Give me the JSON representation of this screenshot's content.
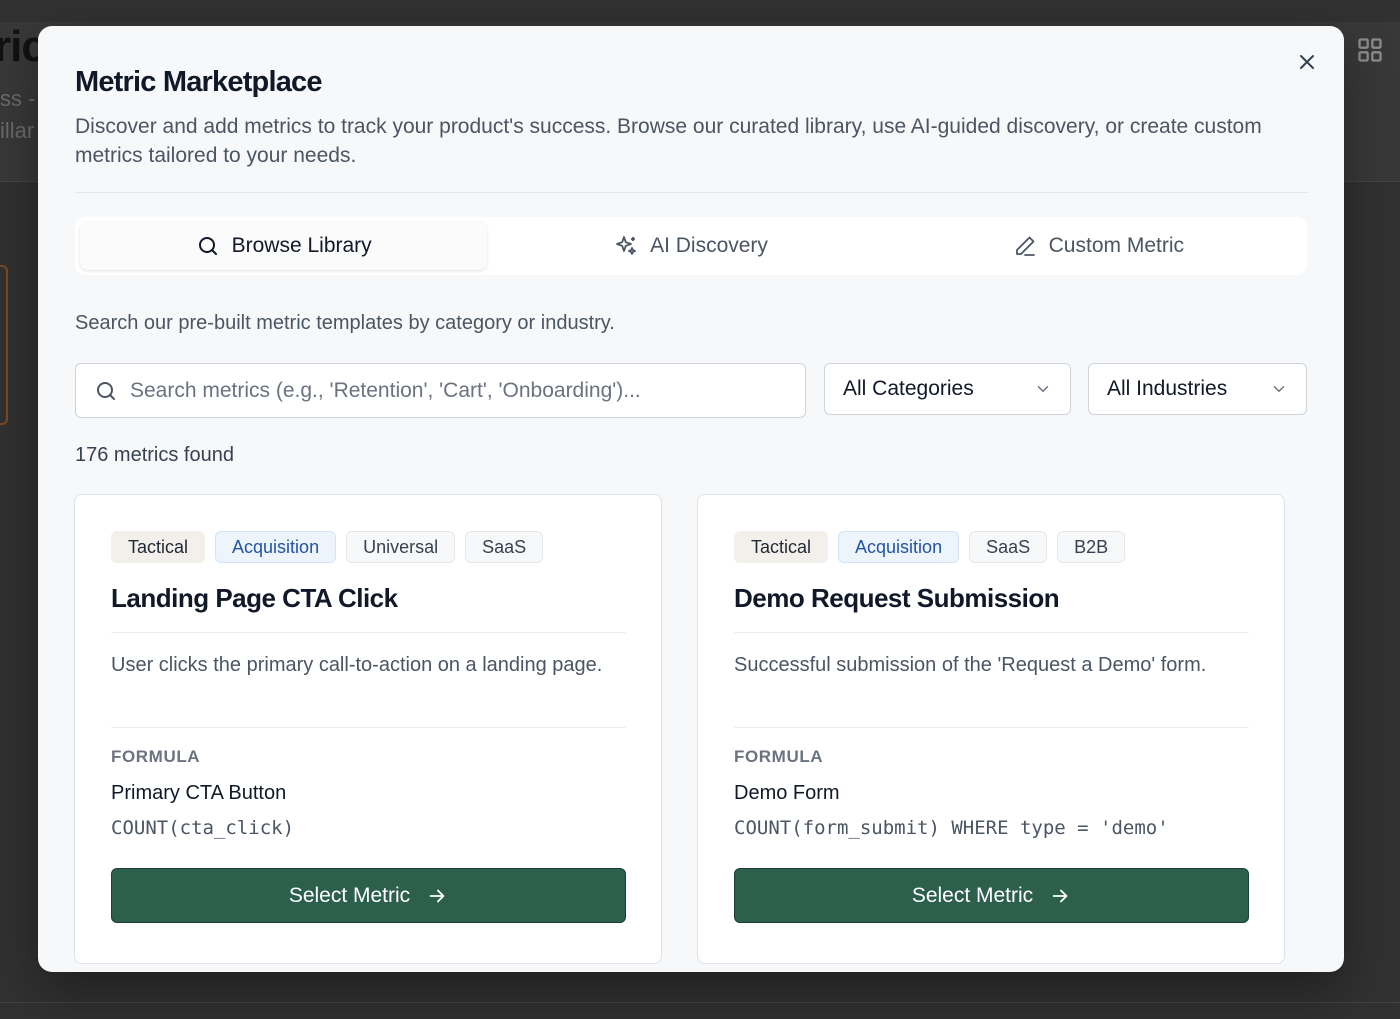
{
  "background": {
    "title_fragment": "ric",
    "subtitle_fragment_1": "ss -",
    "subtitle_fragment_2": "illar",
    "grid_icon": "grid-icon"
  },
  "modal": {
    "title": "Metric Marketplace",
    "description": "Discover and add metrics to track your product's success. Browse our curated library, use AI-guided discovery, or create custom metrics tailored to your needs.",
    "close_icon": "close-icon",
    "tabs": [
      {
        "label": "Browse Library",
        "icon": "search-icon",
        "active": true
      },
      {
        "label": "AI Discovery",
        "icon": "sparkles-icon",
        "active": false
      },
      {
        "label": "Custom Metric",
        "icon": "pencil-icon",
        "active": false
      }
    ],
    "browse_hint": "Search our pre-built metric templates by category or industry.",
    "search": {
      "placeholder": "Search metrics (e.g., 'Retention', 'Cart', 'Onboarding')...",
      "value": ""
    },
    "filters": {
      "category": "All Categories",
      "industry": "All Industries"
    },
    "results_count": "176 metrics found",
    "cards": [
      {
        "tags": [
          "Tactical",
          "Acquisition",
          "Universal",
          "SaaS"
        ],
        "title": "Landing Page CTA Click",
        "description": "User clicks the primary call-to-action on a landing page.",
        "formula_label": "FORMULA",
        "formula_name": "Primary CTA Button",
        "formula_expr": "COUNT(cta_click)",
        "button_label": "Select Metric"
      },
      {
        "tags": [
          "Tactical",
          "Acquisition",
          "SaaS",
          "B2B"
        ],
        "title": "Demo Request Submission",
        "description": "Successful submission of the 'Request a Demo' form.",
        "formula_label": "FORMULA",
        "formula_name": "Demo Form",
        "formula_expr": "COUNT(form_submit) WHERE type = 'demo'",
        "button_label": "Select Metric"
      }
    ]
  },
  "colors": {
    "primary_button": "#2c5f4c",
    "acquisition_tag_text": "#2353a6",
    "tactical_tag_bg": "#f3efea"
  }
}
